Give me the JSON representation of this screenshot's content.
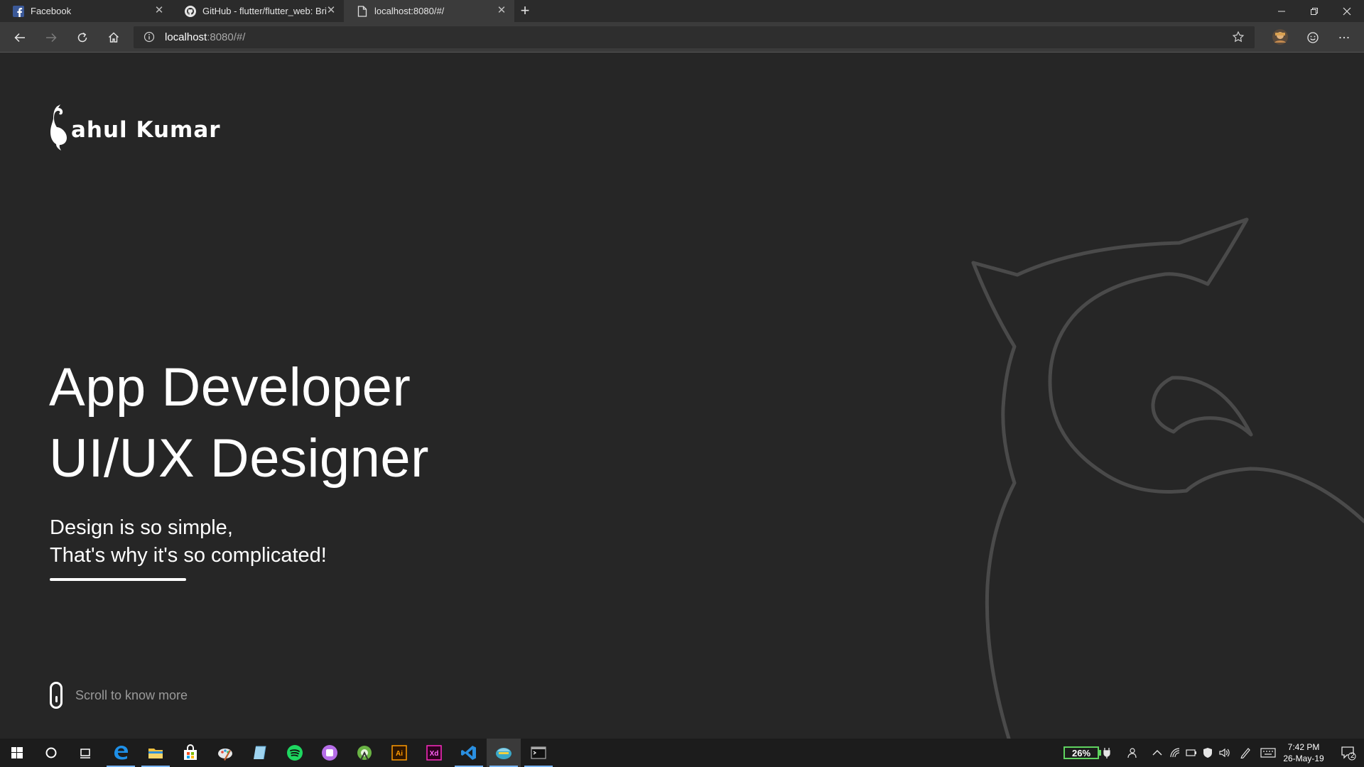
{
  "browser": {
    "tabs": [
      {
        "title": "Facebook",
        "icon": "facebook-icon",
        "active": false
      },
      {
        "title": "GitHub - flutter/flutter_web: Brin",
        "icon": "github-icon",
        "active": false
      },
      {
        "title": "localhost:8080/#/",
        "icon": "page-icon",
        "active": true
      }
    ],
    "url_host": "localhost",
    "url_rest": ":8080/#/"
  },
  "page": {
    "logo_text": "ahul Kumar",
    "headline_1": "App Developer",
    "headline_2": "UI/UX Designer",
    "tagline_1": "Design is so simple,",
    "tagline_2": "That's why it's so complicated!",
    "scroll_hint": "Scroll to know more",
    "colors": {
      "background": "#262626",
      "outline": "#4a4a4a",
      "text": "#ffffff",
      "muted": "#9a9a9a"
    }
  },
  "taskbar": {
    "apps": [
      "windows-start-icon",
      "cortana-icon",
      "task-view-icon",
      "edge-icon",
      "file-explorer-icon",
      "store-icon",
      "paint-icon",
      "notes-icon",
      "spotify-icon",
      "podcast-icon",
      "android-studio-icon",
      "illustrator-icon",
      "xd-icon",
      "vscode-icon",
      "flutter-browser-icon",
      "terminal-icon"
    ],
    "battery": "26%",
    "time": "7:42 PM",
    "date": "26-May-19",
    "notification_count": "2"
  }
}
